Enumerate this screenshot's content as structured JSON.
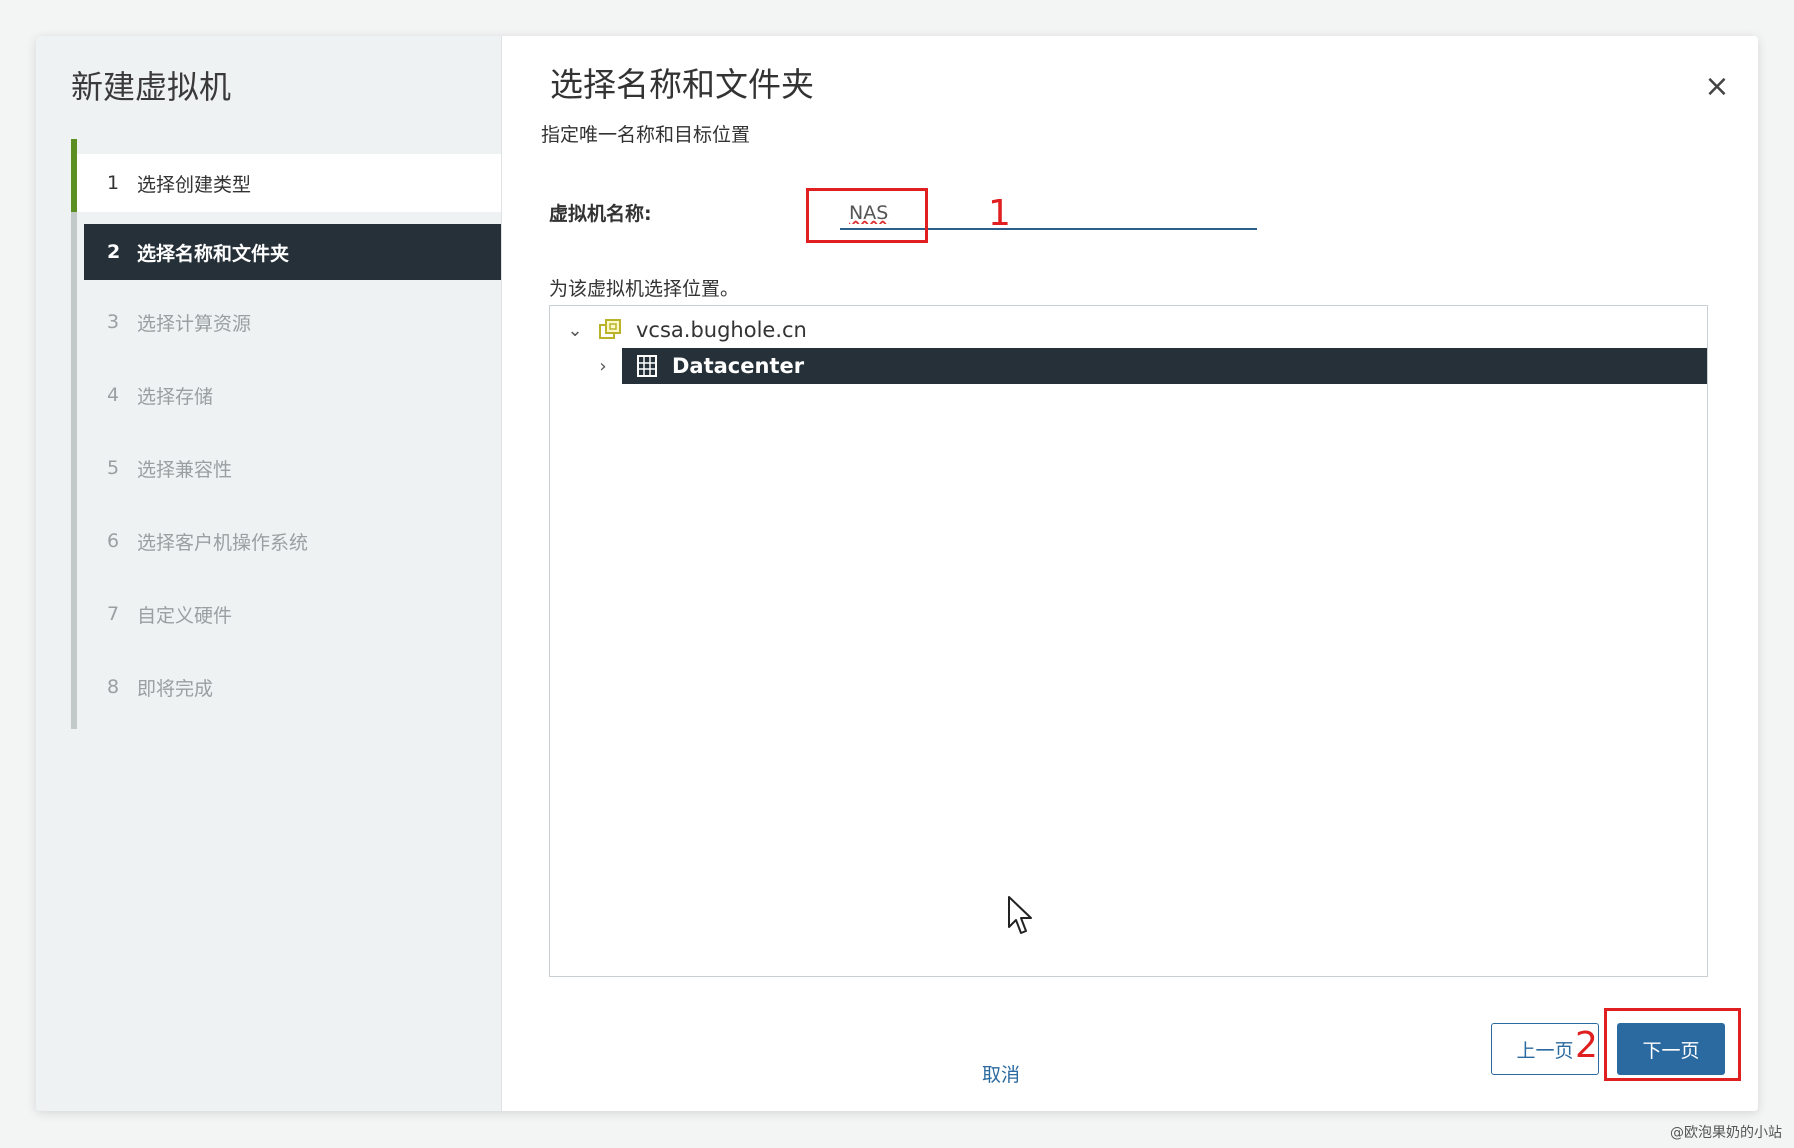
{
  "wizard": {
    "title": "新建虚拟机",
    "steps": [
      {
        "num": "1",
        "label": "选择创建类型",
        "state": "done"
      },
      {
        "num": "2",
        "label": "选择名称和文件夹",
        "state": "active"
      },
      {
        "num": "3",
        "label": "选择计算资源",
        "state": "pending"
      },
      {
        "num": "4",
        "label": "选择存储",
        "state": "pending"
      },
      {
        "num": "5",
        "label": "选择兼容性",
        "state": "pending"
      },
      {
        "num": "6",
        "label": "选择客户机操作系统",
        "state": "pending"
      },
      {
        "num": "7",
        "label": "自定义硬件",
        "state": "pending"
      },
      {
        "num": "8",
        "label": "即将完成",
        "state": "pending"
      }
    ]
  },
  "page": {
    "title": "选择名称和文件夹",
    "subtitle": "指定唯一名称和目标位置",
    "close_icon": "×"
  },
  "form": {
    "vm_name_label": "虚拟机名称:",
    "vm_name_value": "NAS",
    "location_label": "为该虚拟机选择位置。"
  },
  "tree": {
    "root": {
      "label": "vcsa.bughole.cn",
      "icon": "vcenter-icon",
      "expanded": true
    },
    "children": [
      {
        "label": "Datacenter",
        "icon": "datacenter-icon",
        "selected": true,
        "expanded": false
      }
    ]
  },
  "buttons": {
    "cancel": "取消",
    "back": "上一页",
    "next": "下一页"
  },
  "annotations": {
    "marker1": "1",
    "marker2": "2"
  },
  "watermark": "@欧泡果奶的小站",
  "colors": {
    "accent": "#2b6aa0",
    "selected_bg": "#253038",
    "progress": "#5b8f22",
    "annotation": "#e02020"
  }
}
